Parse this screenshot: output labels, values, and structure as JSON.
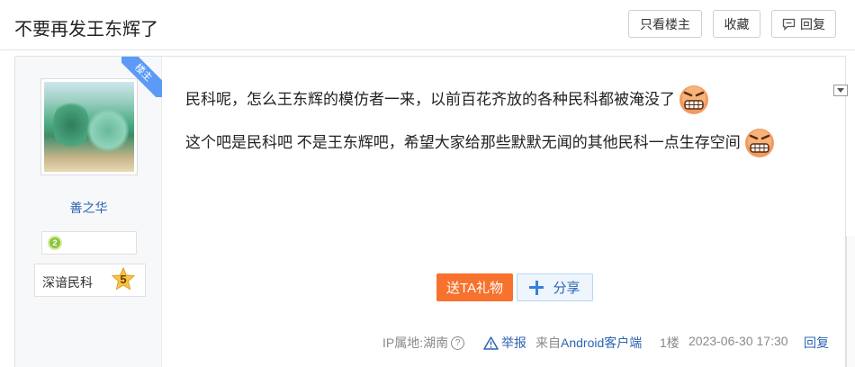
{
  "thread": {
    "title": "不要再发王东辉了",
    "buttons": {
      "only_op": "只看楼主",
      "favorite": "收藏",
      "reply": "回复"
    }
  },
  "author": {
    "ribbon": "楼主",
    "username": "善之华",
    "level": "2",
    "badge_label": "深谙民科",
    "badge_level": "5"
  },
  "post": {
    "lines": [
      "民科呢，怎么王东辉的模仿者一来，以前百花齐放的各种民科都被淹没了",
      "这个吧是民科吧 不是王东辉吧，希望大家给那些默默无闻的其他民科一点生存空间"
    ],
    "gift_button": "送TA礼物",
    "share_button": "分享"
  },
  "meta": {
    "ip": "IP属地:湖南",
    "report": "举报",
    "source_prefix": "来自",
    "source_client": "Android客户端",
    "floor": "1楼",
    "time": "2023-06-30 17:30",
    "reply": "回复"
  },
  "icons": {
    "emoji": "angry-grin-face-icon",
    "reply": "speech-bubble-icon",
    "report": "warning-triangle-icon",
    "share": "plus-icon",
    "help": "question-circle-icon"
  },
  "colors": {
    "accent_blue": "#2d64b3",
    "gift_orange": "#f7722e",
    "ribbon_blue": "#5b9af6"
  }
}
